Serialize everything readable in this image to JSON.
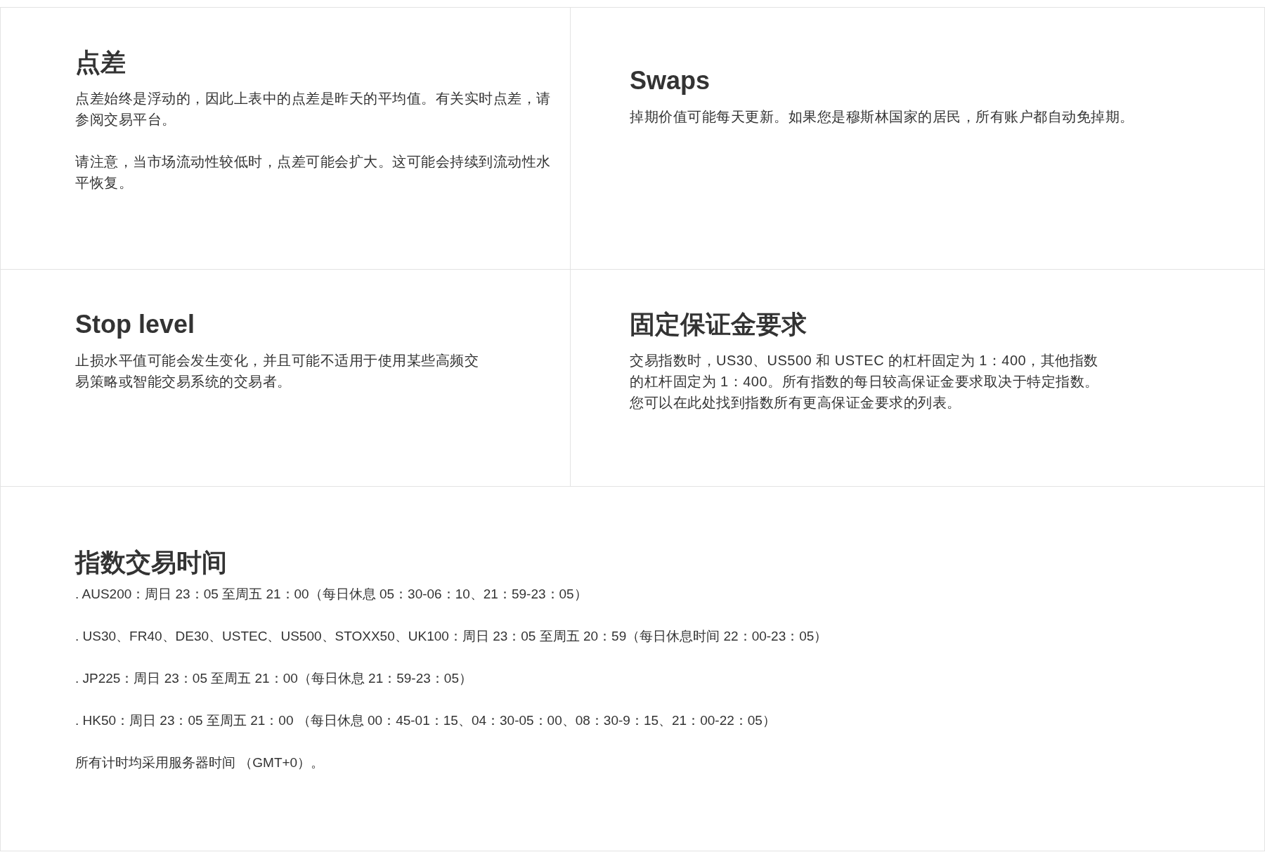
{
  "cards": [
    {
      "title": "点差",
      "paragraphs": [
        "点差始终是浮动的，因此上表中的点差是昨天的平均值。有关实时点差，请参阅交易平台。",
        "请注意，当市场流动性较低时，点差可能会扩大。这可能会持续到流动性水平恢复。"
      ]
    },
    {
      "title": "Swaps",
      "paragraphs": [
        "掉期价值可能每天更新。如果您是穆斯林国家的居民，所有账户都自动免掉期。"
      ]
    },
    {
      "title": "Stop level",
      "paragraphs": [
        "止损水平值可能会发生变化，并且可能不适用于使用某些高频交易策略或智能交易系统的交易者。"
      ]
    },
    {
      "title": "固定保证金要求",
      "paragraphs": [
        "交易指数时，US30、US500 和 USTEC 的杠杆固定为 1：400，其他指数的杠杆固定为 1：400。所有指数的每日较高保证金要求取决于特定指数。您可以在此处找到指数所有更高保证金要求的列表。"
      ]
    }
  ],
  "trading_hours": {
    "title": "指数交易时间",
    "lines": [
      ". AUS200：周日 23：05 至周五 21：00（每日休息 05：30-06：10、21：59-23：05）",
      ". US30、FR40、DE30、USTEC、US500、STOXX50、UK100：周日 23：05 至周五 20：59（每日休息时间 22：00-23：05）",
      ". JP225：周日 23：05 至周五 21：00（每日休息 21：59-23：05）",
      ". HK50：周日 23：05 至周五 21：00 （每日休息 00：45-01：15、04：30-05：00、08：30-9：15、21：00-22：05）"
    ],
    "note": "所有计时均采用服务器时间 （GMT+0）。"
  }
}
